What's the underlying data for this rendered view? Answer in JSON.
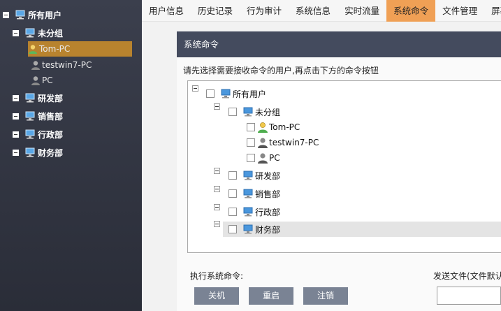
{
  "sidebar": {
    "root": "所有用户",
    "group_ungrouped": "未分组",
    "users": [
      "Tom-PC",
      "testwin7-PC",
      "PC"
    ],
    "groups": [
      "研发部",
      "销售部",
      "行政部",
      "财务部"
    ]
  },
  "nav": {
    "tabs": [
      "用户信息",
      "历史记录",
      "行为审计",
      "系统信息",
      "实时流量",
      "系统命令",
      "文件管理",
      "屏幕监"
    ],
    "active_tab": "系统命令"
  },
  "panel": {
    "title": "系统命令",
    "instruction": "请先选择需要接收命令的用户,再点击下方的命令按钮",
    "tree": {
      "root": "所有用户",
      "group_ungrouped": "未分组",
      "users": [
        "Tom-PC",
        "testwin7-PC",
        "PC"
      ],
      "groups": [
        "研发部",
        "销售部",
        "行政部",
        "财务部"
      ]
    },
    "exec_label": "执行系统命令:",
    "send_file_label": "发送文件(文件默认",
    "buttons": {
      "shutdown": "关机",
      "restart": "重启",
      "logout": "注销"
    }
  },
  "colors": {
    "sidebar_bg": "#2f3340",
    "sidebar_selected": "#b8832e",
    "active_tab": "#f0a055",
    "panel_header": "#444b5e",
    "button": "#7a8394"
  }
}
